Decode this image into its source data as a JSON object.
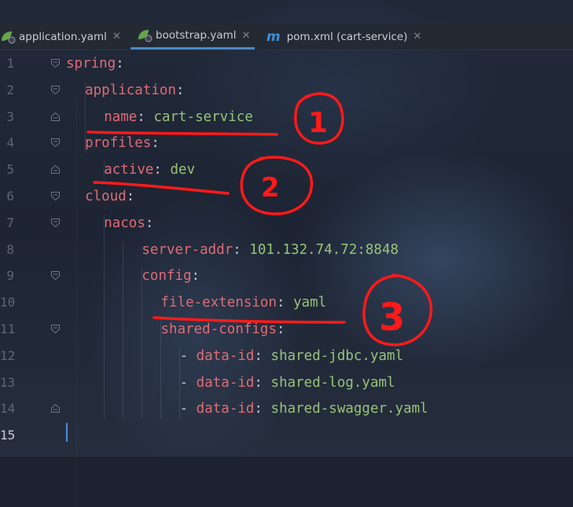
{
  "tabs": [
    {
      "label": "application.yaml",
      "close": "✕",
      "icon": "spring-leaf-icon",
      "active": false
    },
    {
      "label": "bootstrap.yaml",
      "close": "✕",
      "icon": "spring-leaf-icon",
      "active": true
    },
    {
      "label": "pom.xml (cart-service)",
      "close": "✕",
      "icon": "maven-m-icon",
      "active": false
    }
  ],
  "colors": {
    "key": "#e06c75",
    "value": "#98c379",
    "punctuation": "#c5c8ce",
    "annotation": "#ff1a1a",
    "tab_active": "#4a88c7"
  },
  "code": [
    {
      "n": "1",
      "key": "spring",
      "value": ""
    },
    {
      "n": "2",
      "key": "application",
      "value": ""
    },
    {
      "n": "3",
      "key": "name",
      "value": "cart-service"
    },
    {
      "n": "4",
      "key": "profiles",
      "value": ""
    },
    {
      "n": "5",
      "key": "active",
      "value": "dev"
    },
    {
      "n": "6",
      "key": "cloud",
      "value": ""
    },
    {
      "n": "7",
      "key": "nacos",
      "value": ""
    },
    {
      "n": "8",
      "key": "server-addr",
      "value": "101.132.74.72:8848"
    },
    {
      "n": "9",
      "key": "config",
      "value": ""
    },
    {
      "n": "10",
      "key": "file-extension",
      "value": "yaml"
    },
    {
      "n": "11",
      "key": "shared-configs",
      "value": ""
    },
    {
      "n": "12",
      "dash": "- ",
      "key": "data-id",
      "value": "shared-jdbc.yaml"
    },
    {
      "n": "13",
      "dash": "- ",
      "key": "data-id",
      "value": "shared-log.yaml"
    },
    {
      "n": "14",
      "dash": "- ",
      "key": "data-id",
      "value": "shared-swagger.yaml"
    },
    {
      "n": "15",
      "key": "",
      "value": ""
    }
  ],
  "annotations": [
    "1",
    "2",
    "3"
  ]
}
